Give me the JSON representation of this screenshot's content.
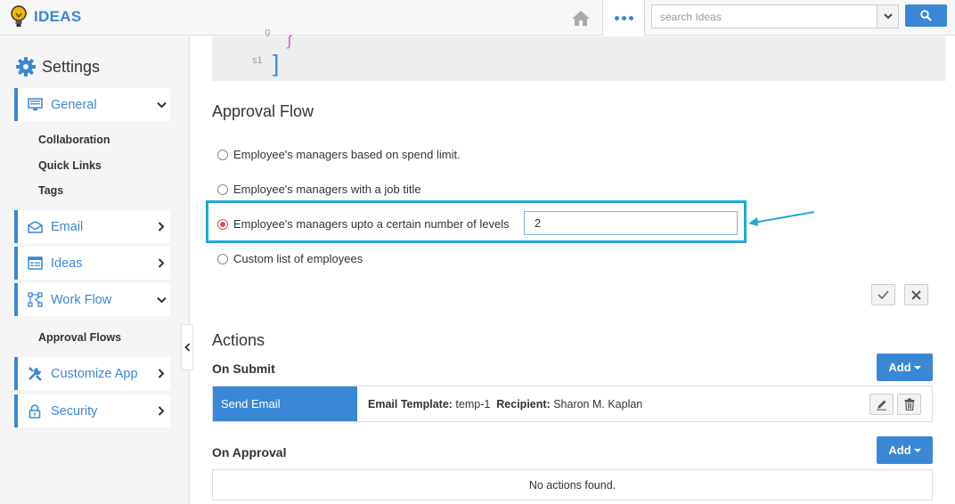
{
  "app": {
    "name": "IDEAS"
  },
  "search": {
    "placeholder": "search Ideas"
  },
  "sidebar": {
    "title": "Settings",
    "items": [
      {
        "label": "General",
        "expanded": true,
        "subitems": [
          "Collaboration",
          "Quick Links",
          "Tags"
        ]
      },
      {
        "label": "Email",
        "expanded": false
      },
      {
        "label": "Ideas",
        "expanded": false
      },
      {
        "label": "Work Flow",
        "expanded": true,
        "subitems": [
          "Approval Flows"
        ]
      },
      {
        "label": "Customize App",
        "expanded": false
      },
      {
        "label": "Security",
        "expanded": false
      }
    ]
  },
  "code_preview": {
    "line_label": "s1"
  },
  "approval_flow": {
    "title": "Approval Flow",
    "options": [
      {
        "label": "Employee's managers based on spend limit.",
        "selected": false
      },
      {
        "label": "Employee's managers with a job title",
        "selected": false
      },
      {
        "label": "Employee's managers upto a certain number of levels",
        "selected": true
      },
      {
        "label": "Custom list of employees",
        "selected": false
      }
    ],
    "levels_value": "2"
  },
  "actions": {
    "title": "Actions",
    "on_submit": {
      "label": "On Submit",
      "add_label": "Add",
      "rows": [
        {
          "type": "Send Email",
          "template_label": "Email Template:",
          "template_value": "temp-1",
          "recipient_label": "Recipient:",
          "recipient_value": "Sharon M. Kaplan"
        }
      ]
    },
    "on_approval": {
      "label": "On Approval",
      "add_label": "Add",
      "empty_text": "No actions found."
    }
  },
  "colors": {
    "accent": "#3a87d6",
    "highlight": "#1ea8d9",
    "radio_selected": "#d9534f"
  }
}
